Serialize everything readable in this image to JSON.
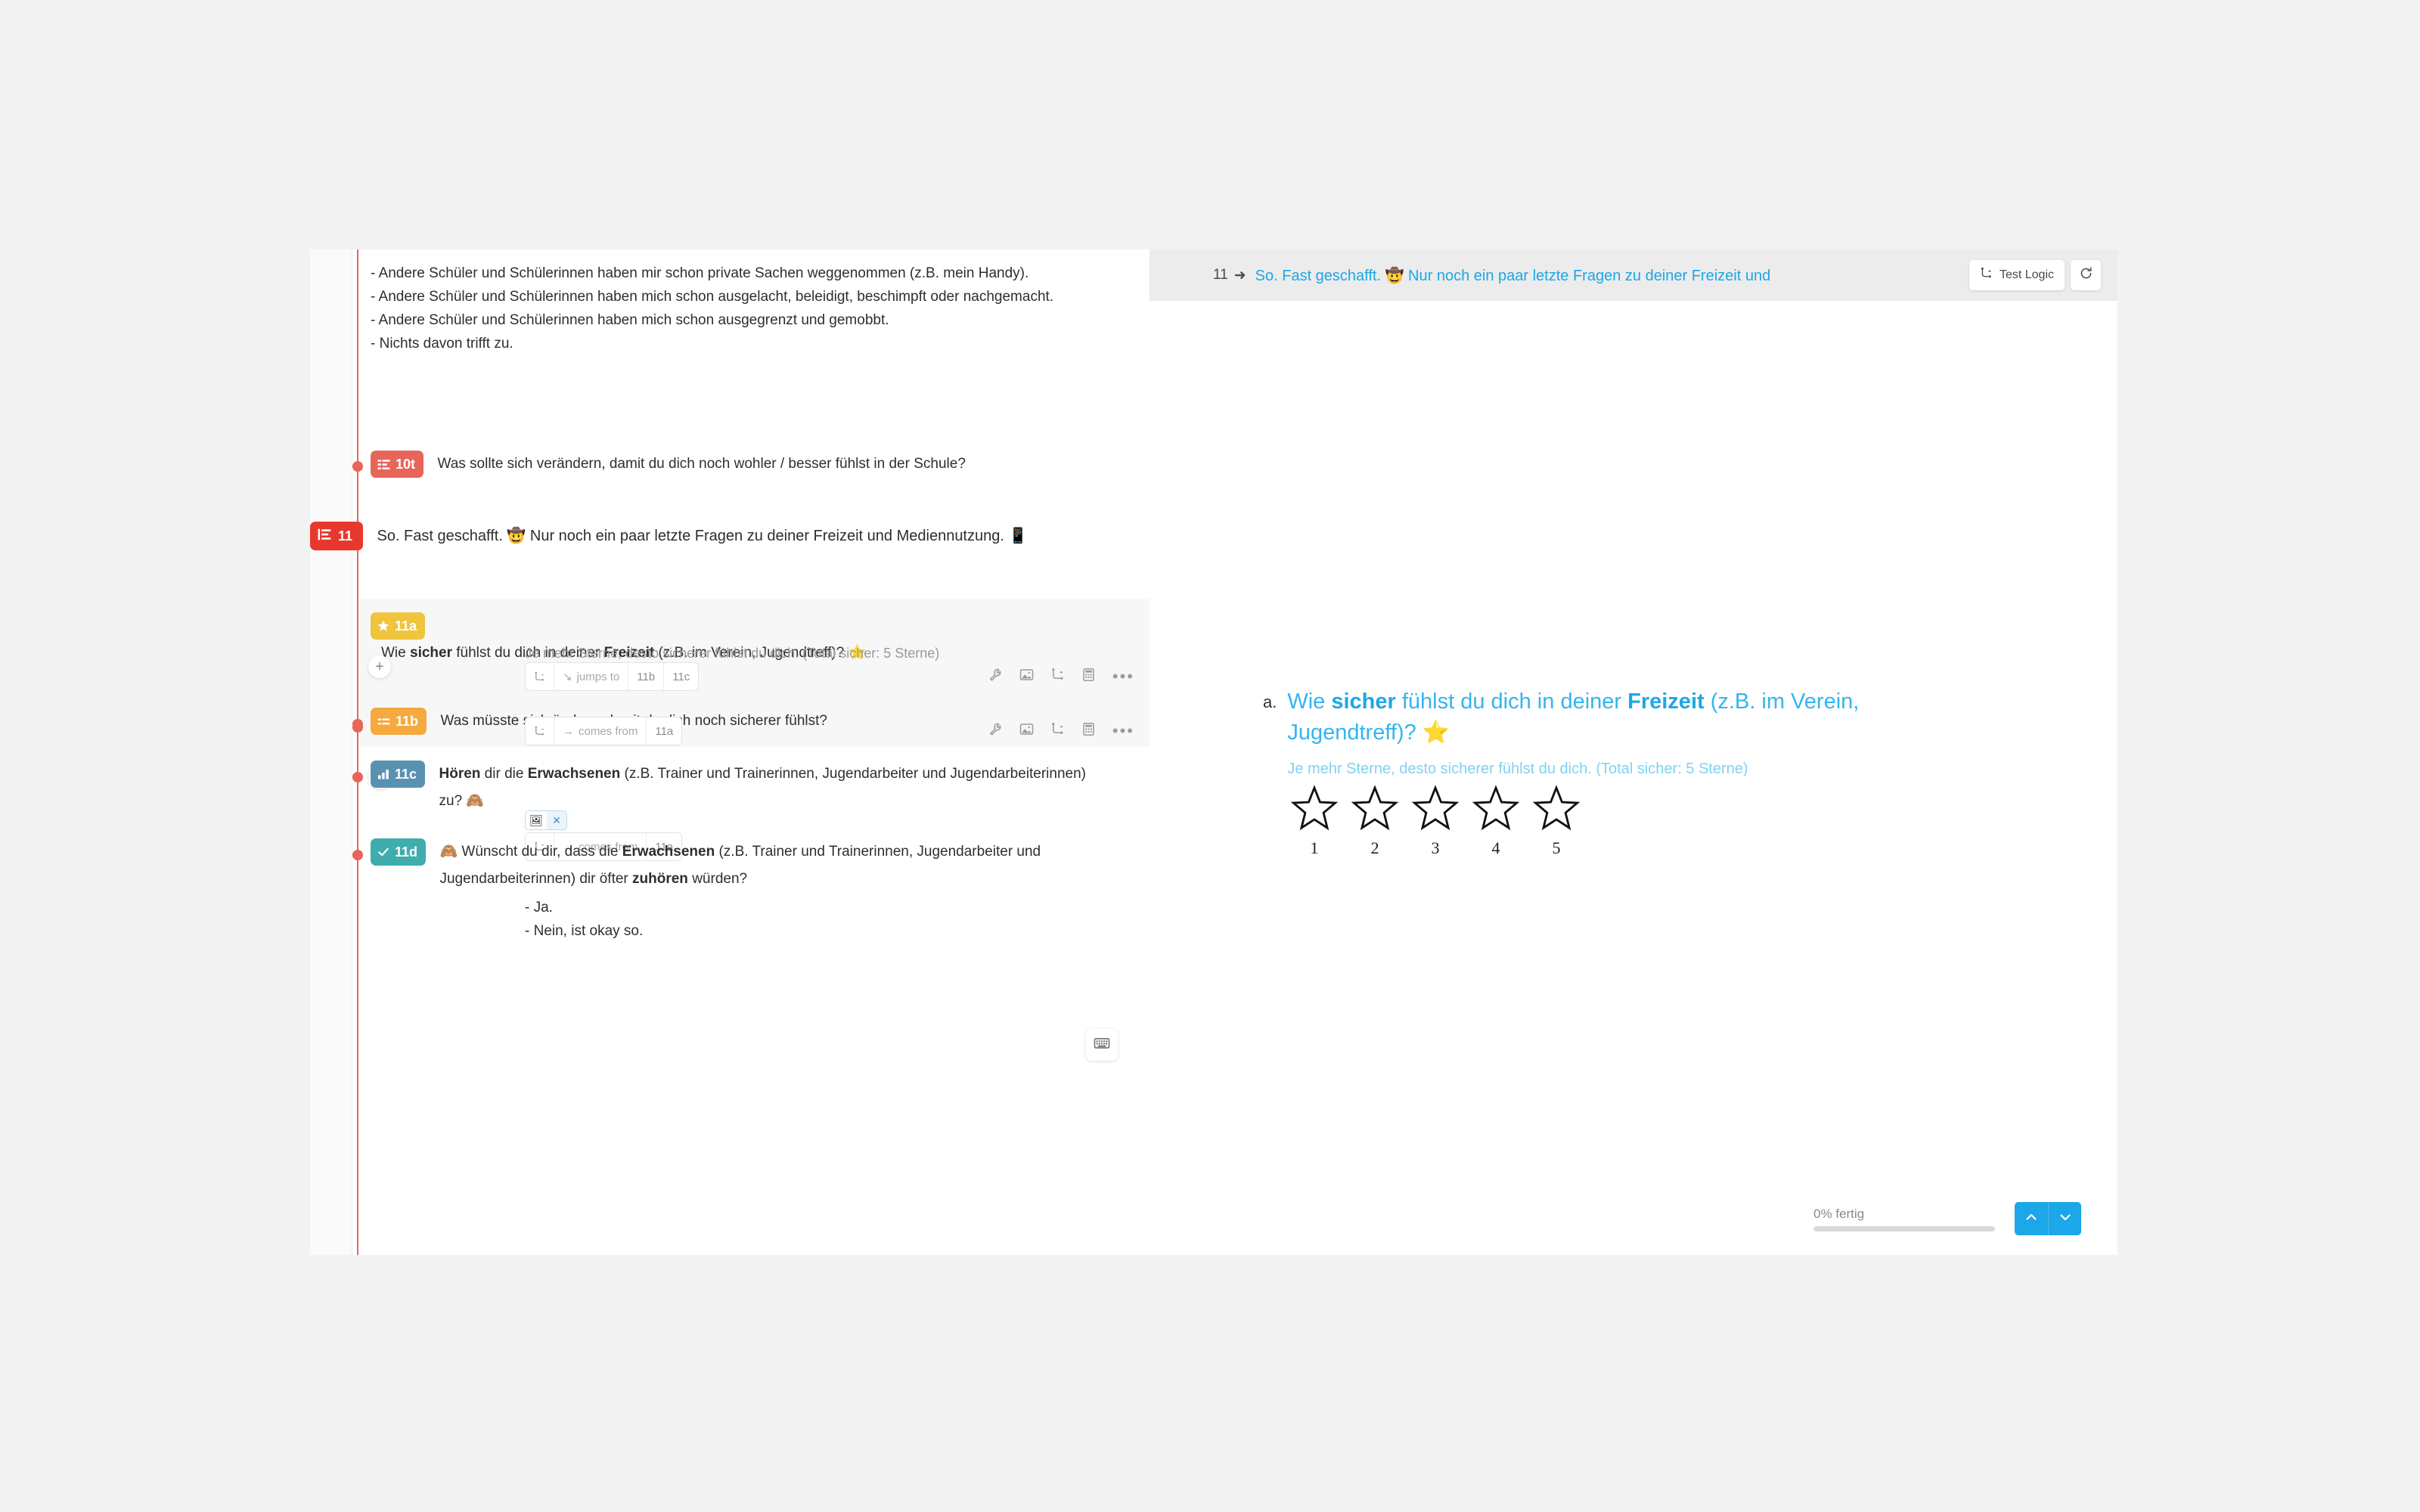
{
  "editor": {
    "previous_options": [
      "- Andere Schüler und Schülerinnen haben mir schon private Sachen weggenommen (z.B. mein Handy).",
      "- Andere Schüler und Schülerinnen haben mich schon ausgelacht, beleidigt, beschimpft oder nachgemacht.",
      "- Andere Schüler und Schülerinnen haben mich schon ausgegrenzt und gemobbt.",
      "- Nichts davon trifft zu."
    ],
    "q10t": {
      "code": "10t",
      "icon": "choice-list-icon",
      "color": "#e8655a",
      "text": "Was sollte sich verändern, damit du dich noch wohler / besser fühlst in der Schule?"
    },
    "section11": {
      "code": "11",
      "icon": "section-icon",
      "color": "#e8382e",
      "text": "So. Fast geschafft. 🤠 Nur noch ein paar letzte Fragen zu deiner Freizeit und Mediennutzung. 📱"
    },
    "q11a": {
      "code": "11a",
      "icon": "star-rating-icon",
      "color": "#efc53f",
      "text_parts": [
        {
          "t": "Wie ",
          "b": false
        },
        {
          "t": "sicher",
          "b": true
        },
        {
          "t": " fühlst du dich in deiner ",
          "b": false
        },
        {
          "t": "Freizeit",
          "b": true
        },
        {
          "t": " (z.B. im Verein, Jugendtreff)? ⭐",
          "b": false
        }
      ],
      "subtitle": "Je mehr Sterne, desto sicherer fühlst du dich. (Total sicher: 5 Sterne)",
      "logic": {
        "icon": "logic-icon",
        "relation_icon": "jump-arrow-icon",
        "relation": "jumps to",
        "targets": [
          "11b",
          "11c"
        ]
      },
      "tools": [
        "wrench-icon",
        "image-icon",
        "logic-icon",
        "calculator-icon",
        "more-icon"
      ]
    },
    "q11b": {
      "code": "11b",
      "icon": "open-text-icon",
      "color": "#f5a93f",
      "text": "Was müsste sich ändern, damit du dich noch sicherer fühlst?",
      "logic": {
        "icon": "logic-icon",
        "relation_icon": "incoming-arrow-icon",
        "relation": "comes from",
        "targets": [
          "11a"
        ]
      },
      "tools": [
        "wrench-icon",
        "image-icon",
        "logic-icon",
        "calculator-icon",
        "more-icon"
      ]
    },
    "q11c": {
      "code": "11c",
      "icon": "bar-chart-icon",
      "color": "#5b91b0",
      "text_parts": [
        {
          "t": "Hören",
          "b": true
        },
        {
          "t": " dir die ",
          "b": false
        },
        {
          "t": "Erwachsenen",
          "b": true
        },
        {
          "t": " (z.B. Trainer und Trainerinnen, Jugendarbeiter und Jugendarbeiterinnen) zu? 🙈",
          "b": false
        }
      ],
      "attachment": {
        "thumb": "🖼",
        "remove": "✕"
      },
      "logic": {
        "icon": "logic-icon",
        "relation_icon": "incoming-arrow-icon",
        "relation": "comes from",
        "targets": [
          "11a"
        ]
      }
    },
    "q11d": {
      "code": "11d",
      "icon": "check-icon",
      "color": "#3fadad",
      "text_parts": [
        {
          "t": "🙈 Wünscht du dir, dass die ",
          "b": false
        },
        {
          "t": "Erwachsenen",
          "b": true
        },
        {
          "t": " (z.B. Trainer und Trainerinnen, Jugendarbeiter und Jugendarbeiterinnen) dir öfter ",
          "b": false
        },
        {
          "t": "zuhören",
          "b": true
        },
        {
          "t": " würden?",
          "b": false
        }
      ],
      "options": [
        "- Ja.",
        "- Nein, ist okay so."
      ],
      "keyboard_icon": "keyboard-icon"
    },
    "add_button_label": "+"
  },
  "preview": {
    "header": {
      "number": "11",
      "arrow": "➜",
      "title": "So. Fast geschafft. 🤠 Nur noch ein paar letzte Fragen zu deiner Freizeit und",
      "test_logic_label": "Test Logic",
      "test_logic_icon": "logic-icon",
      "refresh_icon": "refresh-icon"
    },
    "question": {
      "marker": "a.",
      "text_parts": [
        {
          "t": "Wie ",
          "b": false
        },
        {
          "t": "sicher",
          "b": true
        },
        {
          "t": " fühlst du dich in deiner ",
          "b": false
        },
        {
          "t": "Freizeit",
          "b": true
        },
        {
          "t": " (z.B. im Verein, Jugendtreff)? ⭐",
          "b": false
        }
      ],
      "subtitle": "Je mehr Sterne, desto sicherer fühlst du dich. (Total sicher: 5 Sterne)"
    },
    "rating": {
      "type": "star",
      "icon": "star-outline-icon",
      "labels": [
        "1",
        "2",
        "3",
        "4",
        "5"
      ]
    },
    "footer": {
      "progress_label": "0% fertig",
      "progress_percent": 0,
      "prev_icon": "chevron-up-icon",
      "next_icon": "chevron-down-icon"
    }
  },
  "colors": {
    "accent_blue": "#1ba7e8",
    "timeline_red": "#e8655a",
    "section_red": "#e8382e"
  }
}
